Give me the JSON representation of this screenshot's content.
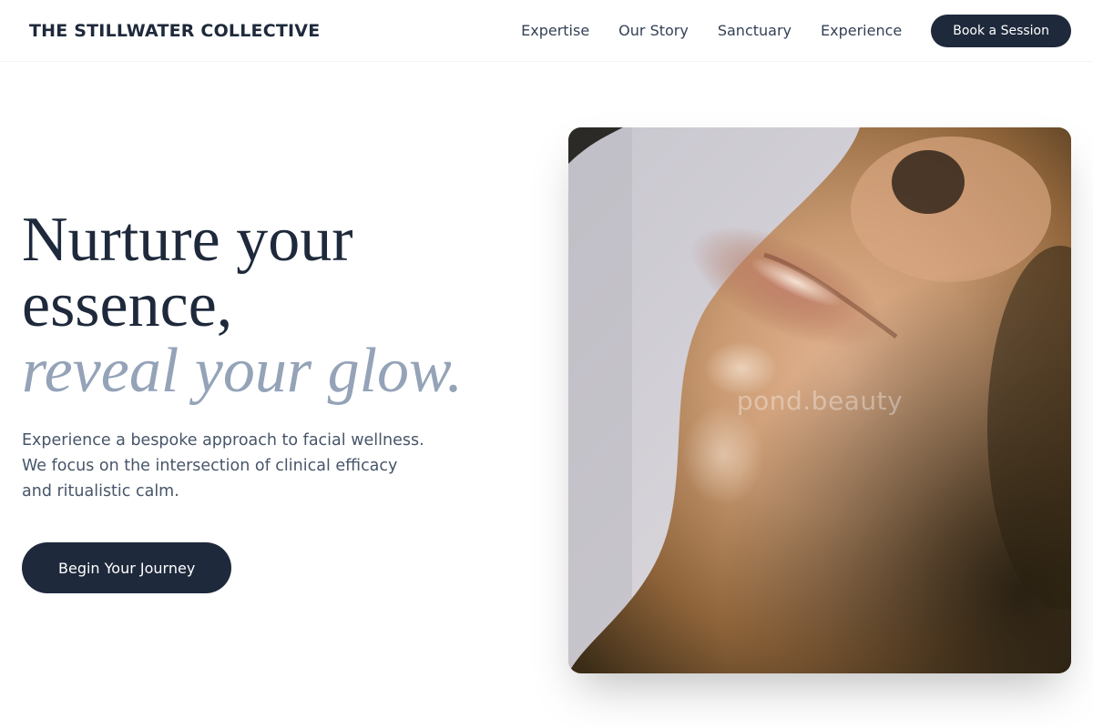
{
  "header": {
    "brand": "THE STILLWATER COLLECTIVE",
    "nav": [
      "Expertise",
      "Our Story",
      "Sanctuary",
      "Experience"
    ],
    "cta_label": "Book a Session"
  },
  "hero": {
    "headline_line1": "Nurture your",
    "headline_line2": "essence,",
    "headline_accent": "reveal your glow.",
    "description": "Experience a bespoke approach to facial wellness. We focus on the intersection of clinical efficacy and ritualistic calm.",
    "cta_label": "Begin Your Journey"
  },
  "image": {
    "watermark": "pond.beauty"
  },
  "colors": {
    "primary": "#1e293b",
    "accent_text": "#94a3b8",
    "body_text": "#475569"
  }
}
